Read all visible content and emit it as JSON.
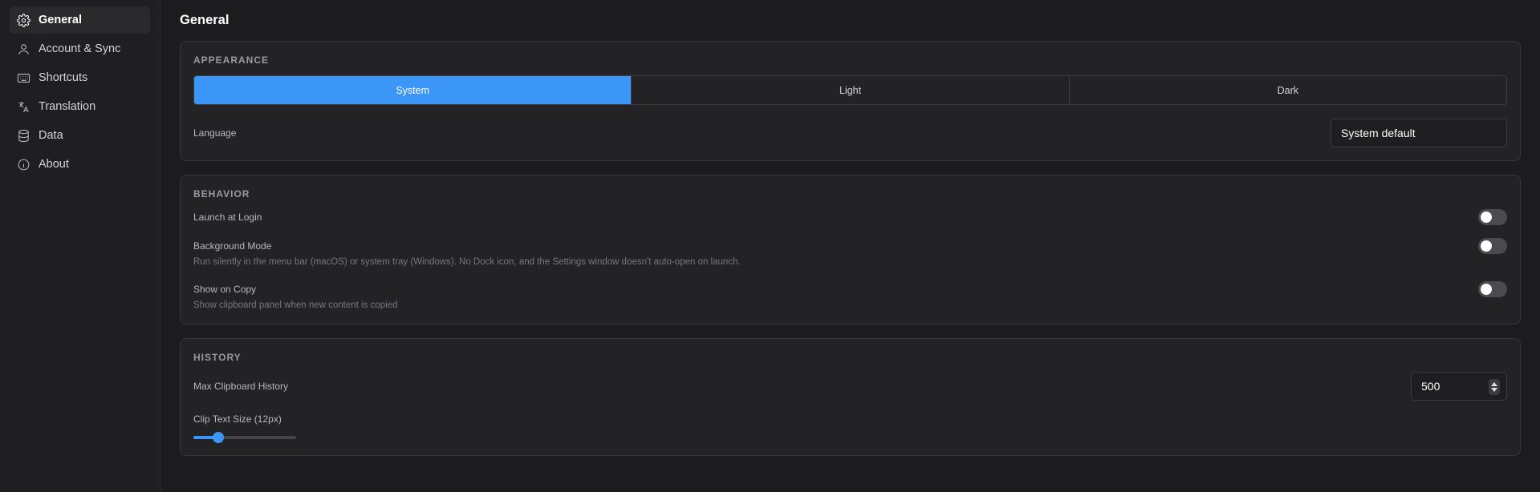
{
  "sidebar": {
    "items": [
      {
        "label": "General",
        "icon": "gear-icon"
      },
      {
        "label": "Account & Sync",
        "icon": "user-icon"
      },
      {
        "label": "Shortcuts",
        "icon": "keyboard-icon"
      },
      {
        "label": "Translation",
        "icon": "translate-icon"
      },
      {
        "label": "Data",
        "icon": "database-icon"
      },
      {
        "label": "About",
        "icon": "info-icon"
      }
    ],
    "active": "General"
  },
  "page": {
    "title": "General"
  },
  "appearance": {
    "heading": "APPEARANCE",
    "options": [
      "System",
      "Light",
      "Dark"
    ],
    "selected": "System",
    "language_label": "Language",
    "language_value": "System default"
  },
  "behavior": {
    "heading": "BEHAVIOR",
    "launch_at_login": {
      "label": "Launch at Login",
      "enabled": false
    },
    "background_mode": {
      "label": "Background Mode",
      "description": "Run silently in the menu bar (macOS) or system tray (Windows). No Dock icon, and the Settings window doesn't auto-open on launch.",
      "enabled": false
    },
    "show_on_copy": {
      "label": "Show on Copy",
      "description": "Show clipboard panel when new content is copied",
      "enabled": false
    }
  },
  "history": {
    "heading": "HISTORY",
    "max_history_label": "Max Clipboard History",
    "max_history_value": "500",
    "clip_text_size_label": "Clip Text Size (12px)",
    "clip_text_size_fraction": 0.24
  },
  "colors": {
    "accent": "#3c96f7",
    "background": "#1c1c1e",
    "card": "#232326"
  }
}
